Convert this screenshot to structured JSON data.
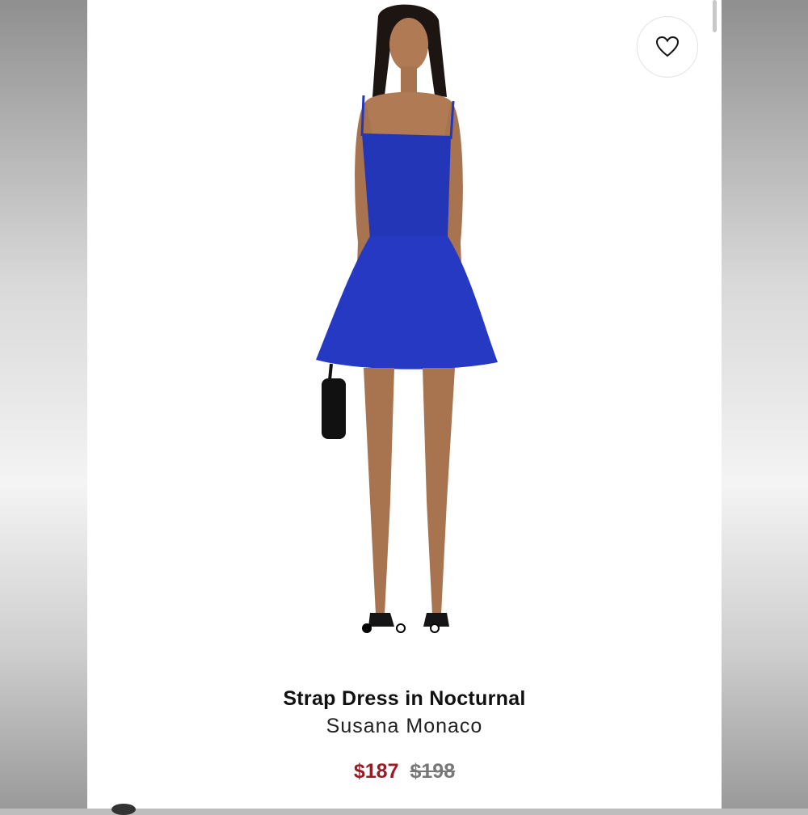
{
  "product": {
    "title": "Strap Dress in Nocturnal",
    "brand": "Susana Monaco",
    "sale_price": "$187",
    "original_price": "$198",
    "image_alt": "Model wearing a blue strapless-look mini dress with thin straps, holding a black handbag"
  },
  "gallery": {
    "total_images": 3,
    "active_index": 0
  },
  "icons": {
    "favorite": "heart-outline-icon"
  },
  "colors": {
    "dress": "#2337b8",
    "sale_price": "#9b1c24",
    "original_price": "#777777"
  }
}
